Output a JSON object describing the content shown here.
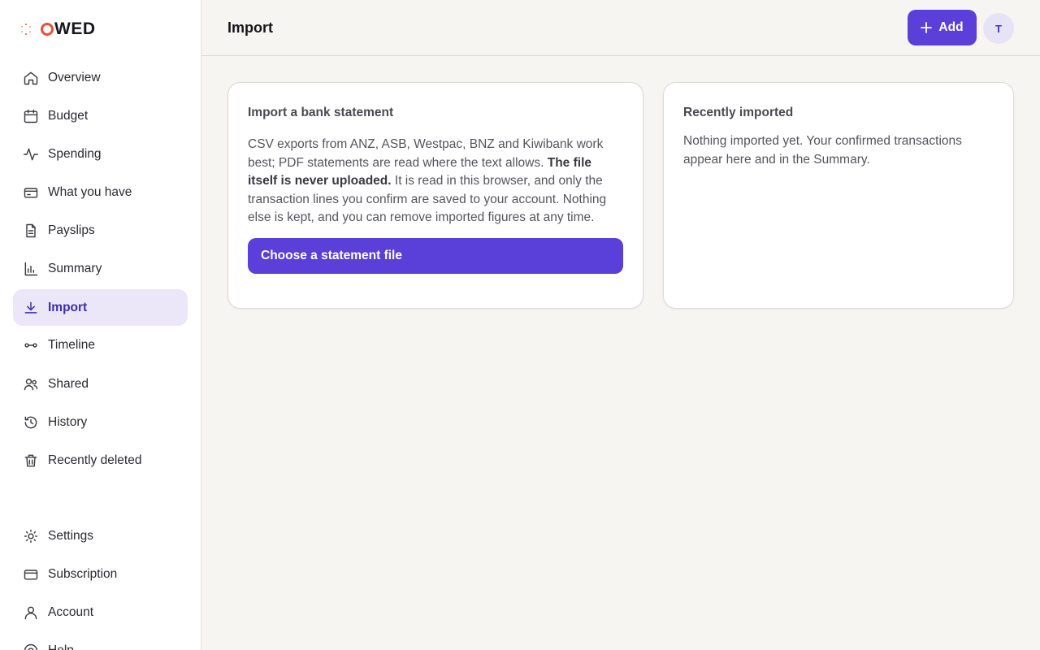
{
  "app": {
    "logo_text": "OWED"
  },
  "sidebar": {
    "items": [
      {
        "label": "Overview",
        "icon": "home-icon"
      },
      {
        "label": "Budget",
        "icon": "calendar-icon"
      },
      {
        "label": "Spending",
        "icon": "activity-icon"
      },
      {
        "label": "What you have",
        "icon": "wallet-icon"
      },
      {
        "label": "Payslips",
        "icon": "document-icon"
      },
      {
        "label": "Summary",
        "icon": "bar-chart-icon"
      },
      {
        "label": "Import",
        "icon": "download-icon",
        "active": true
      },
      {
        "label": "Timeline",
        "icon": "timeline-icon"
      },
      {
        "label": "Shared",
        "icon": "users-icon"
      },
      {
        "label": "History",
        "icon": "history-icon"
      },
      {
        "label": "Recently deleted",
        "icon": "trash-icon"
      }
    ],
    "footer_items": [
      {
        "label": "Settings",
        "icon": "sun-icon"
      },
      {
        "label": "Subscription",
        "icon": "credit-card-icon"
      },
      {
        "label": "Account",
        "icon": "user-icon"
      },
      {
        "label": "Help",
        "icon": "help-icon"
      }
    ]
  },
  "header": {
    "title": "Import",
    "add_label": "Add",
    "avatar_initial": "T"
  },
  "import_card": {
    "title": "Import a bank statement",
    "body_before": "CSV exports from ANZ, ASB, Westpac, BNZ and Kiwibank work best; PDF statements are read where the text allows. ",
    "body_bold": "The file itself is never uploaded.",
    "body_after": " It is read in this browser, and only the transaction lines you confirm are saved to your account. Nothing else is kept, and you can remove imported figures at any time.",
    "button_label": "Choose a statement file"
  },
  "recent_card": {
    "title": "Recently imported",
    "body": "Nothing imported yet. Your confirmed transactions appear here and in the Summary."
  },
  "colors": {
    "accent": "#5a3fd8",
    "active_bg": "#ebe7f8",
    "logo_o": "#e2533a"
  }
}
